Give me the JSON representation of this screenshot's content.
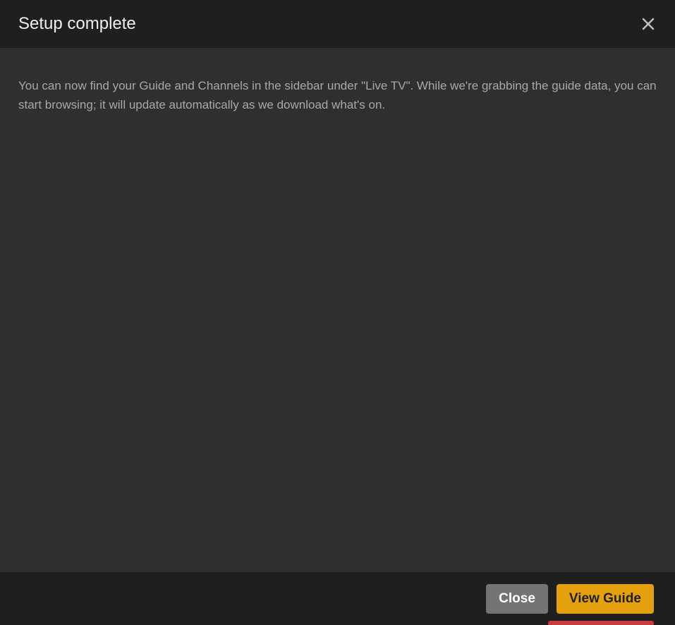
{
  "dialog": {
    "title": "Setup complete",
    "body": "You can now find your Guide and Channels in the sidebar under \"Live TV\". While we're grabbing the guide data, you can start browsing; it will update automatically as we download what's on."
  },
  "buttons": {
    "close": "Close",
    "view_guide": "View Guide"
  }
}
